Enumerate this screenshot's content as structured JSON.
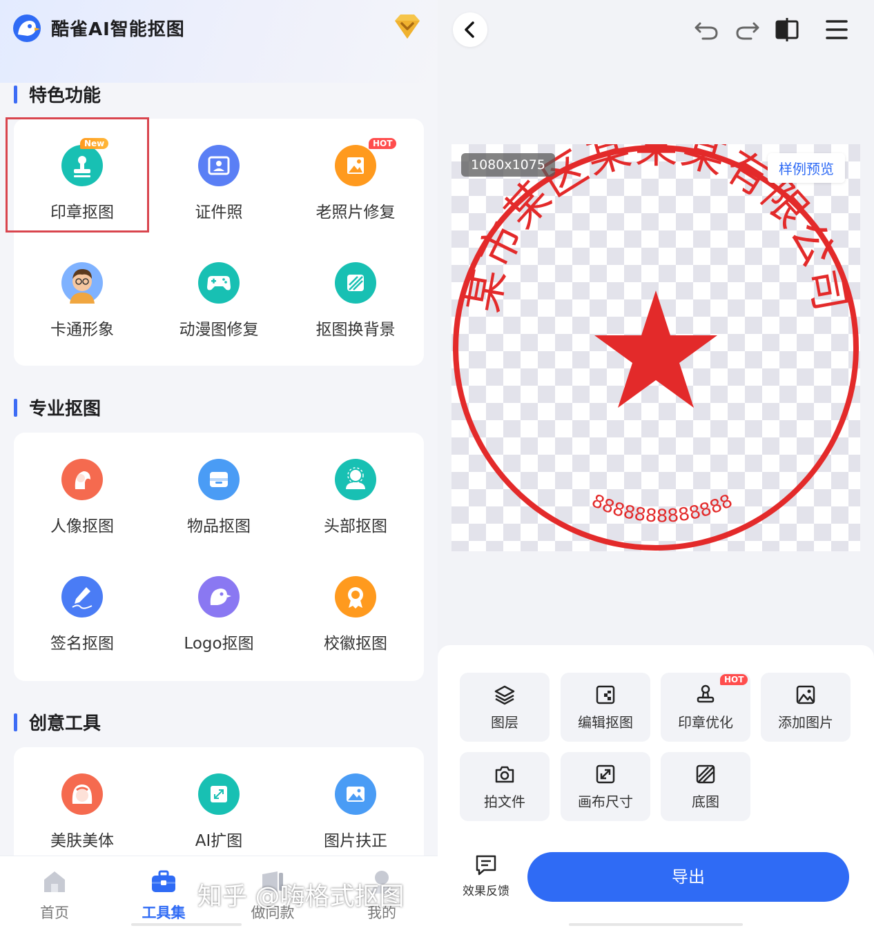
{
  "app": {
    "title": "酷雀AI智能抠图"
  },
  "sections": [
    {
      "title": "特色功能",
      "tools": [
        {
          "label": "印章抠图",
          "icon": "stamp-icon",
          "badge": "New"
        },
        {
          "label": "证件照",
          "icon": "id-photo-icon"
        },
        {
          "label": "老照片修复",
          "icon": "old-photo-icon",
          "badge": "HOT"
        },
        {
          "label": "卡通形象",
          "icon": "cartoon-avatar-icon"
        },
        {
          "label": "动漫图修复",
          "icon": "gamepad-icon"
        },
        {
          "label": "抠图换背景",
          "icon": "background-swap-icon"
        }
      ]
    },
    {
      "title": "专业抠图",
      "tools": [
        {
          "label": "人像抠图",
          "icon": "portrait-icon"
        },
        {
          "label": "物品抠图",
          "icon": "object-box-icon"
        },
        {
          "label": "头部抠图",
          "icon": "head-icon"
        },
        {
          "label": "签名抠图",
          "icon": "signature-pen-icon"
        },
        {
          "label": "Logo抠图",
          "icon": "logo-bird-icon"
        },
        {
          "label": "校徽抠图",
          "icon": "badge-medal-icon"
        }
      ]
    },
    {
      "title": "创意工具",
      "tools": [
        {
          "label": "美肤美体",
          "icon": "beauty-face-icon"
        },
        {
          "label": "AI扩图",
          "icon": "expand-image-icon"
        },
        {
          "label": "图片扶正",
          "icon": "straighten-image-icon"
        }
      ]
    }
  ],
  "tabbar": [
    {
      "label": "首页",
      "icon": "home-icon"
    },
    {
      "label": "工具集",
      "icon": "toolbox-icon",
      "active": true
    },
    {
      "label": "做同款",
      "icon": "template-icon"
    },
    {
      "label": "我的",
      "icon": "profile-icon"
    }
  ],
  "editor": {
    "dimensions": "1080x1075",
    "sample_preview": "样例预览",
    "stamp": {
      "company": "某市某区某某某有限公司",
      "number": "8888888888888",
      "color": "#e32a2a"
    },
    "actions": [
      {
        "label": "图层",
        "icon": "layers-icon"
      },
      {
        "label": "编辑抠图",
        "icon": "edit-cutout-icon"
      },
      {
        "label": "印章优化",
        "icon": "stamp-optimize-icon",
        "badge": "HOT"
      },
      {
        "label": "添加图片",
        "icon": "add-image-icon"
      },
      {
        "label": "拍文件",
        "icon": "camera-icon"
      },
      {
        "label": "画布尺寸",
        "icon": "canvas-size-icon"
      },
      {
        "label": "底图",
        "icon": "base-image-icon"
      }
    ],
    "feedback": "效果反馈",
    "export": "导出"
  },
  "watermark": "知乎 @嗨格式抠图",
  "colors": {
    "accent": "#2f6bf5",
    "highlight_box": "#d9454e",
    "stamp_red": "#e32a2a"
  }
}
